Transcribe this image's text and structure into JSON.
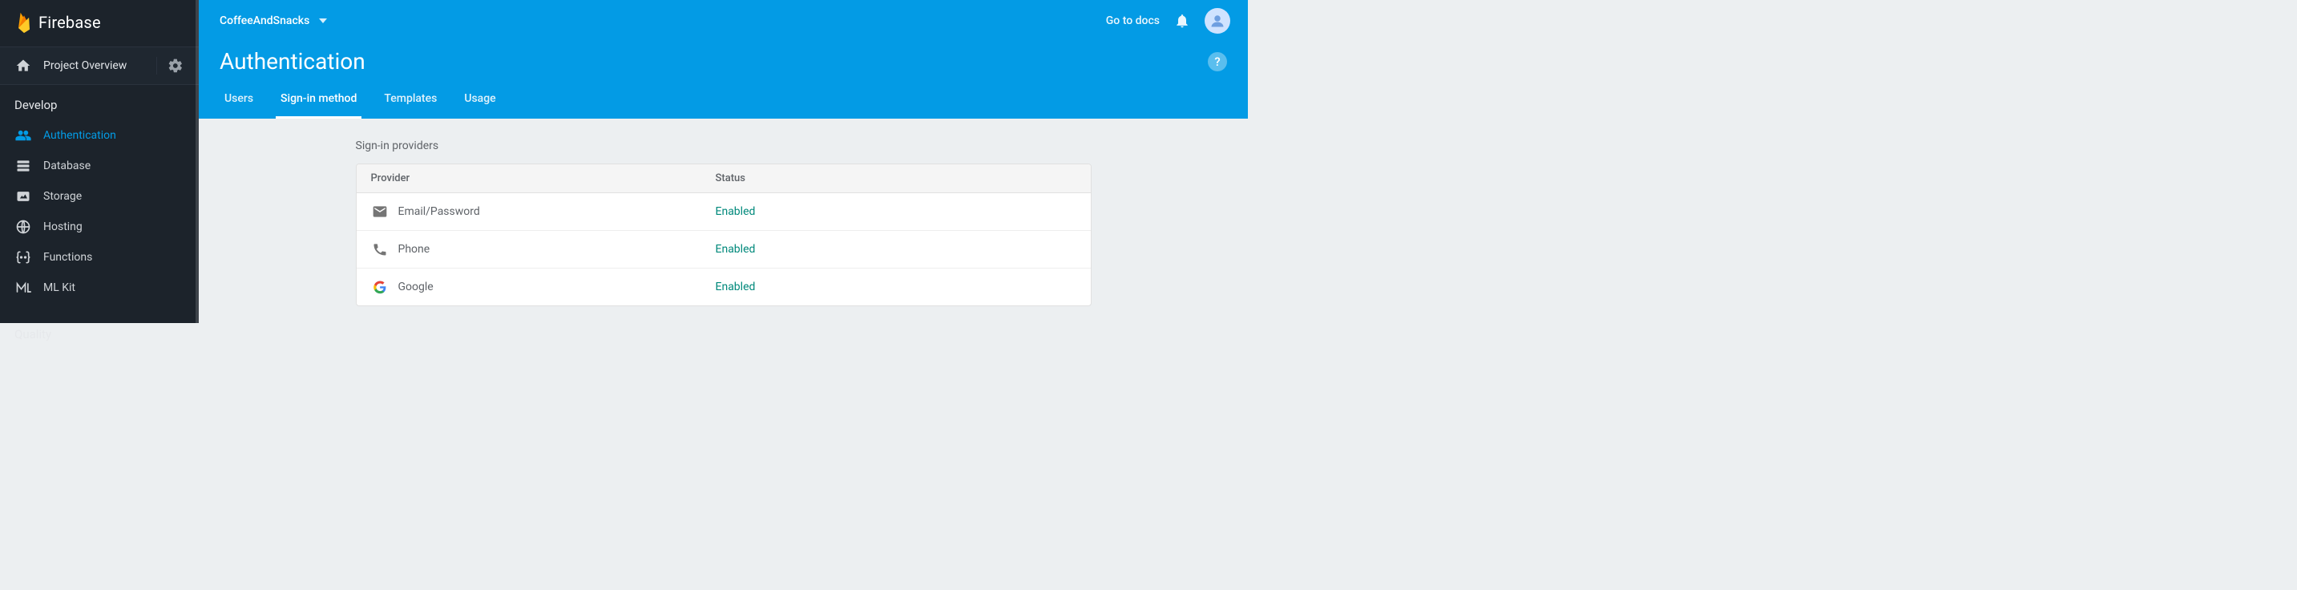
{
  "brand": "Firebase",
  "sidebar": {
    "project_overview_label": "Project Overview",
    "section_develop": "Develop",
    "section_quality": "Quality",
    "items": [
      {
        "label": "Authentication",
        "icon": "people-icon",
        "active": true
      },
      {
        "label": "Database",
        "icon": "database-icon",
        "active": false
      },
      {
        "label": "Storage",
        "icon": "storage-icon",
        "active": false
      },
      {
        "label": "Hosting",
        "icon": "hosting-icon",
        "active": false
      },
      {
        "label": "Functions",
        "icon": "functions-icon",
        "active": false
      },
      {
        "label": "ML Kit",
        "icon": "mlkit-icon",
        "active": false
      }
    ]
  },
  "topbar": {
    "project_name": "CoffeeAndSnacks",
    "docs_label": "Go to docs"
  },
  "page": {
    "title": "Authentication",
    "tabs": [
      {
        "label": "Users",
        "active": false
      },
      {
        "label": "Sign-in method",
        "active": true
      },
      {
        "label": "Templates",
        "active": false
      },
      {
        "label": "Usage",
        "active": false
      }
    ]
  },
  "content": {
    "section_label": "Sign-in providers",
    "columns": {
      "provider": "Provider",
      "status": "Status"
    },
    "providers": [
      {
        "name": "Email/Password",
        "icon": "email-icon",
        "status": "Enabled"
      },
      {
        "name": "Phone",
        "icon": "phone-icon",
        "status": "Enabled"
      },
      {
        "name": "Google",
        "icon": "google-icon",
        "status": "Enabled"
      }
    ]
  }
}
